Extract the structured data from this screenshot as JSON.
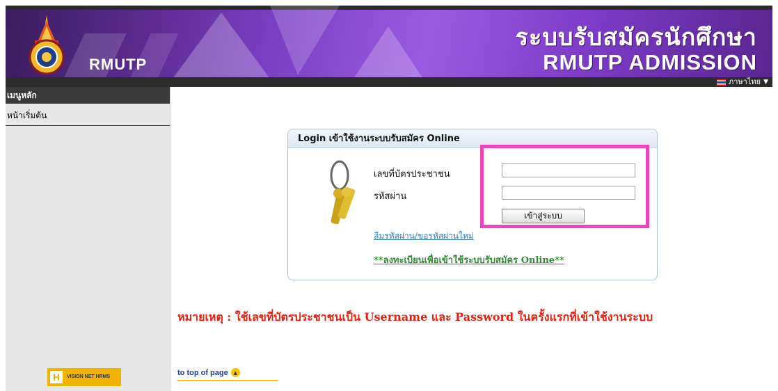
{
  "header": {
    "brand": "RMUTP",
    "title_th": "ระบบรับสมัครนักศึกษา",
    "title_en": "RMUTP ADMISSION",
    "language": "ภาษาไทย"
  },
  "sidebar": {
    "menu_title": "เมนูหลัก",
    "items": [
      {
        "label": "หน้าเริ่มต้น"
      }
    ],
    "vision_logo_text": "VISION NET HRMS"
  },
  "login": {
    "heading": "Login เข้าใช้งานระบบรับสมัคร Online",
    "id_label": "เลขที่บัตรประชาชน",
    "id_value": "",
    "password_label": "รหัสผ่าน",
    "password_value": "",
    "submit_label": "เข้าสู่ระบบ",
    "forgot_link": "ลืมรหัสผ่าน/ขอรหัสผ่านใหม่",
    "register_link": "**ลงทะเบียนเพื่อเข้าใช้ระบบรับสมัคร Online**"
  },
  "note": "หมายเหตุ : ใช้เลขที่บัตรประชาชนเป็น Username และ Password ในครั้งแรกที่เข้าใช้งานระบบ",
  "footer": {
    "to_top": "to top of page"
  },
  "colors": {
    "banner_purple": "#7b3fc4",
    "highlight": "#ee44bb",
    "note_red": "#e4200f",
    "link_blue": "#2f7dbd",
    "register_green": "#2f8c2f"
  }
}
